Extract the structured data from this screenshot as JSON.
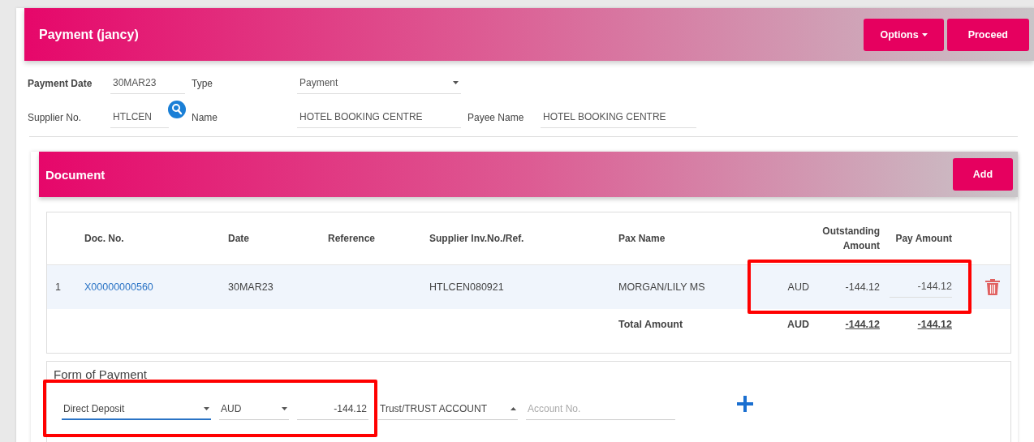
{
  "header": {
    "title": "Payment (jancy)",
    "buttons": [
      {
        "label": "Options",
        "kind": "dropdown"
      },
      {
        "label": "Proceed",
        "kind": "plain"
      }
    ]
  },
  "form": {
    "payment_date": {
      "label": "Payment Date",
      "value": "30MAR23"
    },
    "type": {
      "label": "Type",
      "value": "Payment"
    },
    "supplier_no": {
      "label": "Supplier No.",
      "value": "HTLCEN"
    },
    "name": {
      "label": "Name",
      "value": "HOTEL BOOKING CENTRE"
    },
    "payee_name": {
      "label": "Payee Name",
      "value": "HOTEL BOOKING CENTRE"
    }
  },
  "document": {
    "title": "Document",
    "add_button": "Add",
    "table": {
      "columns": [
        "Doc. No.",
        "Date",
        "Reference",
        "Supplier Inv.No./Ref.",
        "Pax Name",
        "Outstanding Amount",
        "Pay Amount"
      ],
      "rows": [
        {
          "index": "1",
          "doc_no": "X00000000560",
          "date": "30MAR23",
          "supplier_ref": "HTLCEN080921",
          "pax_name": "MORGAN/LILY MS",
          "currency": "AUD",
          "outstanding": "-144.12",
          "pay_amount": "-144.12",
          "highlighted": true
        }
      ],
      "total": {
        "label": "Total Amount",
        "currency": "AUD",
        "outstanding": "-144.12",
        "pay_amount": "-144.12"
      }
    }
  },
  "form_of_payment": {
    "title": "Form of Payment",
    "method": "Direct Deposit",
    "currency": "AUD",
    "amount": "-144.12",
    "account": "Trust/TRUST ACCOUNT",
    "account_no_placeholder": "Account No.",
    "highlighted": true
  }
}
